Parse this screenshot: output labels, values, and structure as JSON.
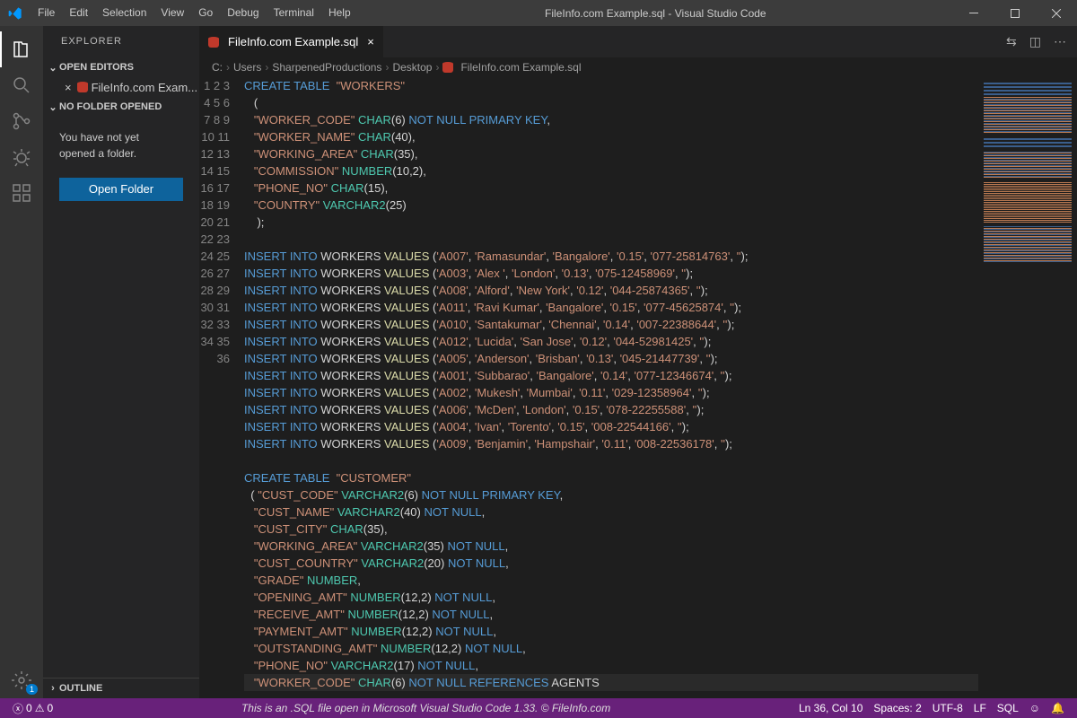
{
  "window": {
    "title": "FileInfo.com Example.sql - Visual Studio Code"
  },
  "menus": [
    "File",
    "Edit",
    "Selection",
    "View",
    "Go",
    "Debug",
    "Terminal",
    "Help"
  ],
  "explorer": {
    "title": "EXPLORER",
    "openEditors": "OPEN EDITORS",
    "openFile": "FileInfo.com Exam...",
    "noFolder": "NO FOLDER OPENED",
    "msg1": "You have not yet",
    "msg2": "opened a folder.",
    "openBtn": "Open Folder",
    "outline": "OUTLINE"
  },
  "tab": {
    "label": "FileInfo.com Example.sql"
  },
  "breadcrumb": [
    "C:",
    "Users",
    "SharpenedProductions",
    "Desktop",
    "FileInfo.com Example.sql"
  ],
  "code": {
    "start": 1,
    "workers_table": "WORKERS",
    "workers_cols": [
      {
        "name": "WORKER_CODE",
        "type": "CHAR",
        "args": "6",
        "extra": "NOT NULL PRIMARY KEY"
      },
      {
        "name": "WORKER_NAME",
        "type": "CHAR",
        "args": "40",
        "extra": ""
      },
      {
        "name": "WORKING_AREA",
        "type": "CHAR",
        "args": "35",
        "extra": ""
      },
      {
        "name": "COMMISSION",
        "type": "NUMBER",
        "args": "10,2",
        "extra": ""
      },
      {
        "name": "PHONE_NO",
        "type": "CHAR",
        "args": "15",
        "extra": ""
      },
      {
        "name": "COUNTRY",
        "type": "VARCHAR2",
        "args": "25",
        "extra": ""
      }
    ],
    "inserts": [
      [
        "A007",
        "Ramasundar",
        "Bangalore",
        "0.15",
        "077-25814763",
        ""
      ],
      [
        "A003",
        "Alex ",
        "London",
        "0.13",
        "075-12458969",
        ""
      ],
      [
        "A008",
        "Alford",
        "New York",
        "0.12",
        "044-25874365",
        ""
      ],
      [
        "A011",
        "Ravi Kumar",
        "Bangalore",
        "0.15",
        "077-45625874",
        ""
      ],
      [
        "A010",
        "Santakumar",
        "Chennai",
        "0.14",
        "007-22388644",
        ""
      ],
      [
        "A012",
        "Lucida",
        "San Jose",
        "0.12",
        "044-52981425",
        ""
      ],
      [
        "A005",
        "Anderson",
        "Brisban",
        "0.13",
        "045-21447739",
        ""
      ],
      [
        "A001",
        "Subbarao",
        "Bangalore",
        "0.14",
        "077-12346674",
        ""
      ],
      [
        "A002",
        "Mukesh",
        "Mumbai",
        "0.11",
        "029-12358964",
        ""
      ],
      [
        "A006",
        "McDen",
        "London",
        "0.15",
        "078-22255588",
        ""
      ],
      [
        "A004",
        "Ivan",
        "Torento",
        "0.15",
        "008-22544166",
        ""
      ],
      [
        "A009",
        "Benjamin",
        "Hampshair",
        "0.11",
        "008-22536178",
        ""
      ]
    ],
    "customer_table": "CUSTOMER",
    "customer_cols": [
      {
        "name": "CUST_CODE",
        "type": "VARCHAR2",
        "args": "6",
        "extra": "NOT NULL PRIMARY KEY",
        "bracket": true
      },
      {
        "name": "CUST_NAME",
        "type": "VARCHAR2",
        "args": "40",
        "extra": "NOT NULL"
      },
      {
        "name": "CUST_CITY",
        "type": "CHAR",
        "args": "35",
        "extra": ""
      },
      {
        "name": "WORKING_AREA",
        "type": "VARCHAR2",
        "args": "35",
        "extra": "NOT NULL"
      },
      {
        "name": "CUST_COUNTRY",
        "type": "VARCHAR2",
        "args": "20",
        "extra": "NOT NULL"
      },
      {
        "name": "GRADE",
        "type": "NUMBER",
        "args": "",
        "extra": ""
      },
      {
        "name": "OPENING_AMT",
        "type": "NUMBER",
        "args": "12,2",
        "extra": "NOT NULL"
      },
      {
        "name": "RECEIVE_AMT",
        "type": "NUMBER",
        "args": "12,2",
        "extra": "NOT NULL"
      },
      {
        "name": "PAYMENT_AMT",
        "type": "NUMBER",
        "args": "12,2",
        "extra": "NOT NULL"
      },
      {
        "name": "OUTSTANDING_AMT",
        "type": "NUMBER",
        "args": "12,2",
        "extra": "NOT NULL"
      },
      {
        "name": "PHONE_NO",
        "type": "VARCHAR2",
        "args": "17",
        "extra": "NOT NULL"
      },
      {
        "name": "WORKER_CODE",
        "type": "CHAR",
        "args": "6",
        "extra": "NOT NULL REFERENCES",
        "ref": "AGENTS"
      }
    ]
  },
  "status": {
    "errors": "0",
    "warnings": "0",
    "caption": "This is an .SQL file open in Microsoft Visual Studio Code 1.33. © FileInfo.com",
    "lncol": "Ln 36, Col 10",
    "spaces": "Spaces: 2",
    "enc": "UTF-8",
    "eol": "LF",
    "lang": "SQL"
  }
}
